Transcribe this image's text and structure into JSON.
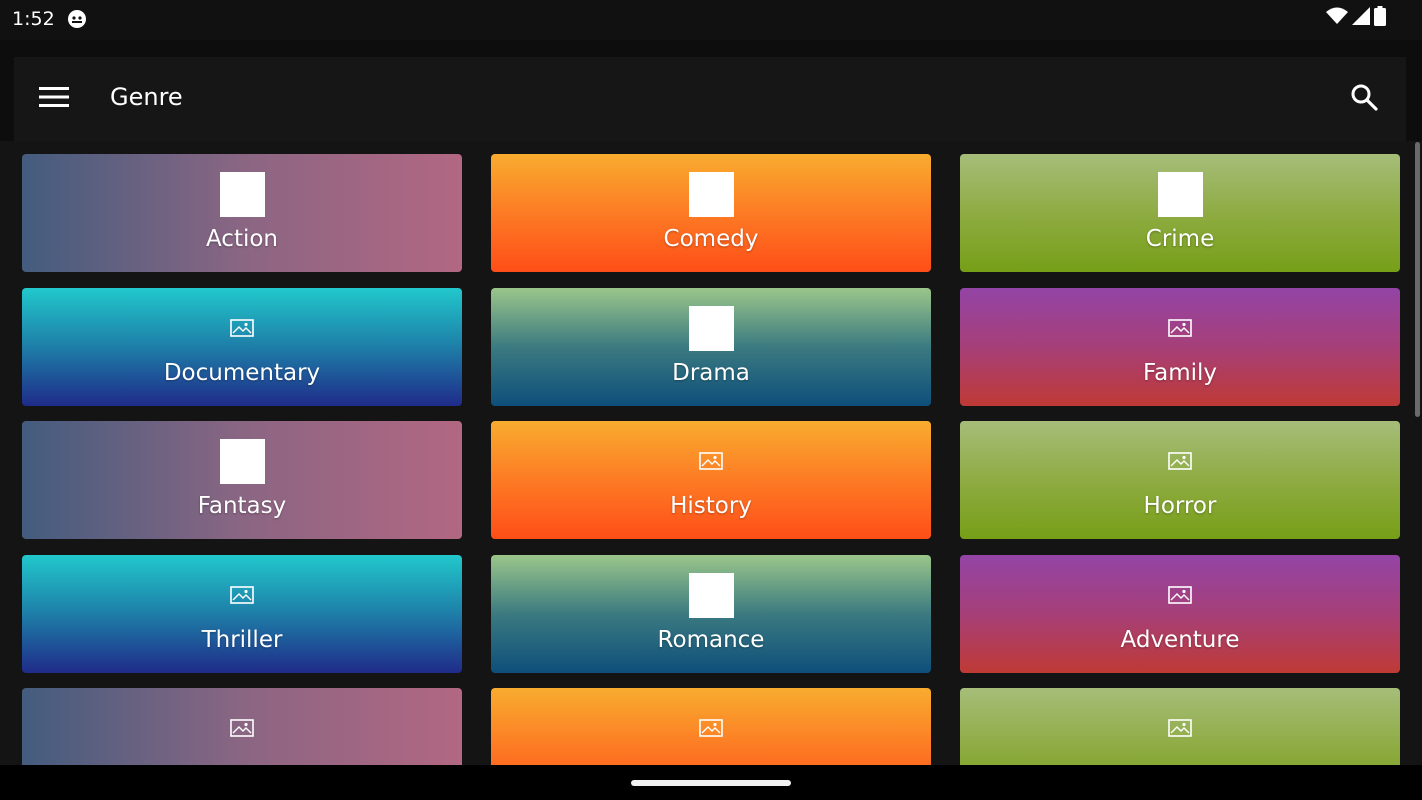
{
  "status": {
    "time": "1:52",
    "notif_icon": "android-notification-icon",
    "wifi_icon": "wifi-icon",
    "signal_icon": "signal-icon",
    "battery_icon": "battery-icon"
  },
  "appbar": {
    "title": "Genre",
    "menu_icon": "hamburger-menu-icon",
    "search_icon": "search-icon"
  },
  "tiles": [
    {
      "label": "Action",
      "image": "thumbnail",
      "style": "purple"
    },
    {
      "label": "Comedy",
      "image": "thumbnail",
      "style": "orange"
    },
    {
      "label": "Crime",
      "image": "thumbnail",
      "style": "green"
    },
    {
      "label": "Documentary",
      "image": "placeholder",
      "style": "cyan"
    },
    {
      "label": "Drama",
      "image": "thumbnail",
      "style": "teal"
    },
    {
      "label": "Family",
      "image": "placeholder",
      "style": "magenta"
    },
    {
      "label": "Fantasy",
      "image": "thumbnail",
      "style": "purple"
    },
    {
      "label": "History",
      "image": "placeholder",
      "style": "orange"
    },
    {
      "label": "Horror",
      "image": "placeholder",
      "style": "green"
    },
    {
      "label": "Thriller",
      "image": "placeholder",
      "style": "cyan"
    },
    {
      "label": "Romance",
      "image": "thumbnail",
      "style": "teal"
    },
    {
      "label": "Adventure",
      "image": "placeholder",
      "style": "magenta"
    },
    {
      "label": "",
      "image": "placeholder",
      "style": "purple"
    },
    {
      "label": "",
      "image": "placeholder",
      "style": "orange"
    },
    {
      "label": "",
      "image": "placeholder",
      "style": "green"
    }
  ]
}
